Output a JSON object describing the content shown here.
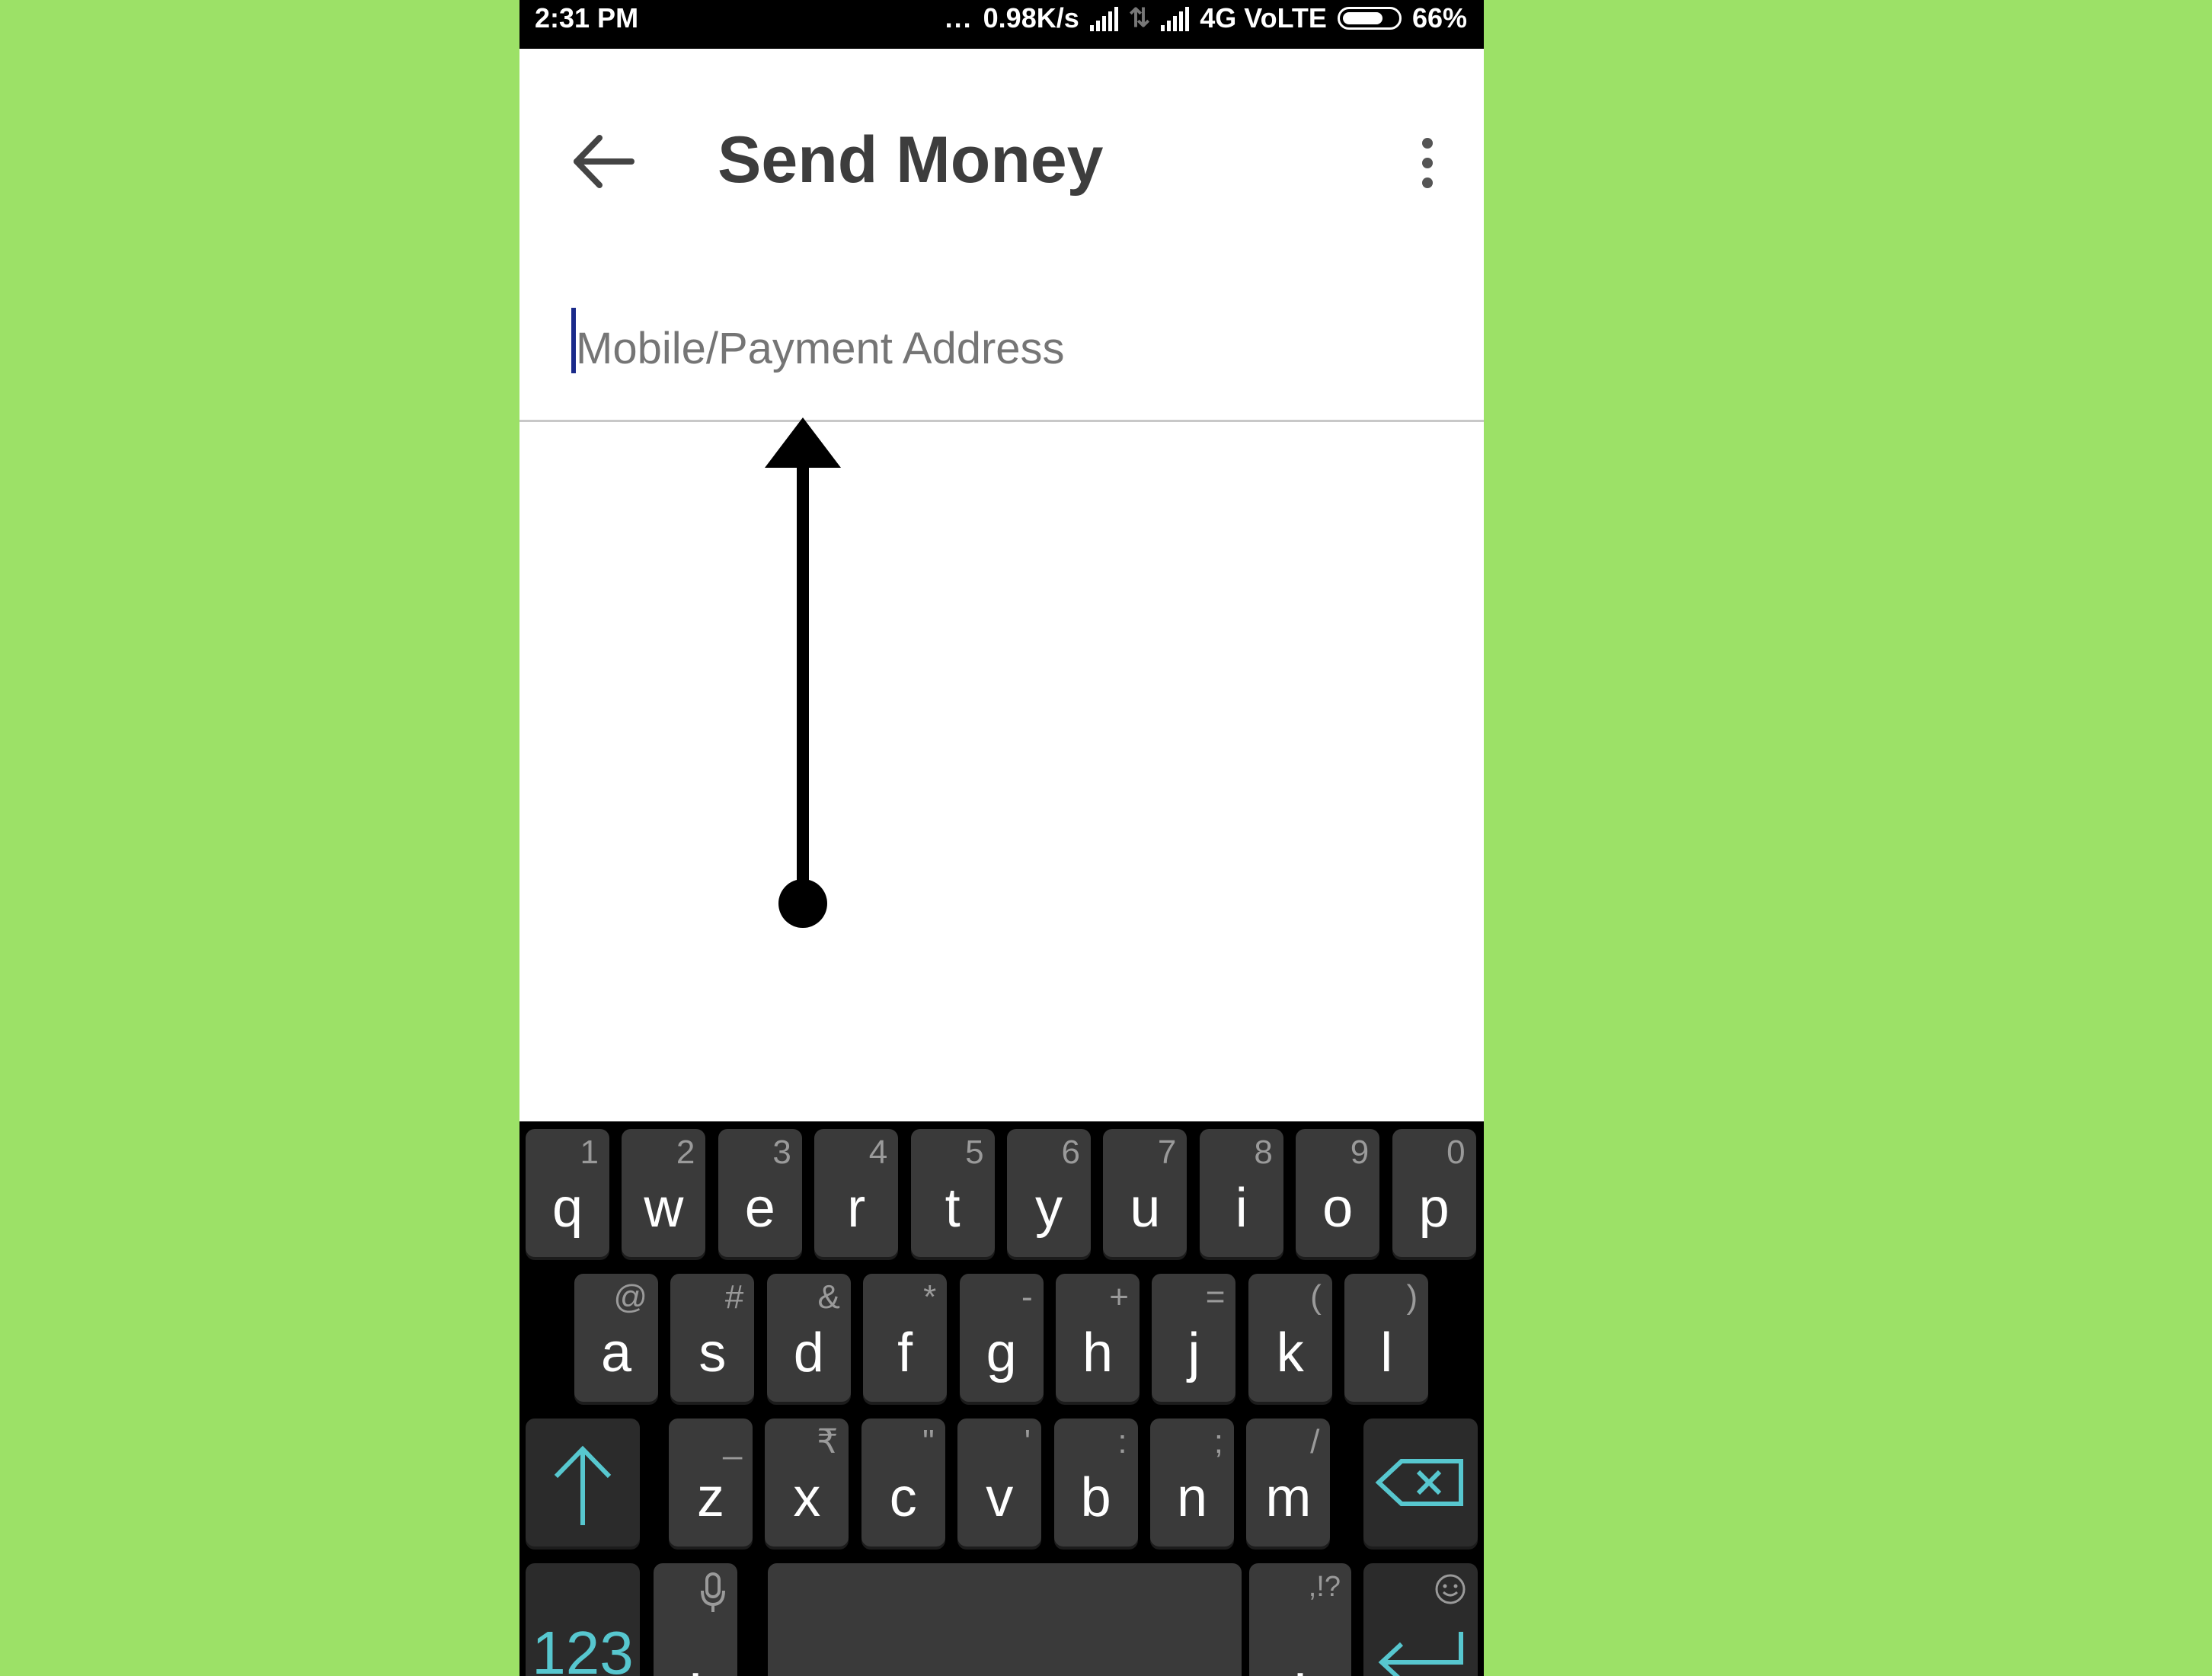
{
  "status_bar": {
    "time": "2:31 PM",
    "dots": "...",
    "speed": "0.98K/s",
    "network": "4G VoLTE",
    "battery": "66%"
  },
  "header": {
    "title": "Send Money",
    "back_icon": "arrow-left-icon",
    "menu_icon": "more-vertical-icon"
  },
  "input": {
    "placeholder": "Mobile/Payment Address",
    "value": ""
  },
  "keyboard": {
    "row1": [
      {
        "key": "q",
        "hint": "1"
      },
      {
        "key": "w",
        "hint": "2"
      },
      {
        "key": "e",
        "hint": "3"
      },
      {
        "key": "r",
        "hint": "4"
      },
      {
        "key": "t",
        "hint": "5"
      },
      {
        "key": "y",
        "hint": "6"
      },
      {
        "key": "u",
        "hint": "7"
      },
      {
        "key": "i",
        "hint": "8"
      },
      {
        "key": "o",
        "hint": "9"
      },
      {
        "key": "p",
        "hint": "0"
      }
    ],
    "row2": [
      {
        "key": "a",
        "hint": "@"
      },
      {
        "key": "s",
        "hint": "#"
      },
      {
        "key": "d",
        "hint": "&"
      },
      {
        "key": "f",
        "hint": "*"
      },
      {
        "key": "g",
        "hint": "-"
      },
      {
        "key": "h",
        "hint": "+"
      },
      {
        "key": "j",
        "hint": "="
      },
      {
        "key": "k",
        "hint": "("
      },
      {
        "key": "l",
        "hint": ")"
      }
    ],
    "row3": [
      {
        "key": "z",
        "hint": "_"
      },
      {
        "key": "x",
        "hint": "₹"
      },
      {
        "key": "c",
        "hint": "\""
      },
      {
        "key": "v",
        "hint": "'"
      },
      {
        "key": "b",
        "hint": ":"
      },
      {
        "key": "n",
        "hint": ";"
      },
      {
        "key": "m",
        "hint": "/"
      }
    ],
    "shift_icon": "shift-arrow-icon",
    "backspace_icon": "backspace-icon",
    "numbers_label": "123",
    "comma": {
      "key": ",",
      "hint_icon": "microphone-icon"
    },
    "period": {
      "key": ".",
      "hint": ",!?"
    },
    "enter_icon": "enter-icon",
    "emoji_icon": "smiley-icon",
    "accent_color": "#57c7cf"
  }
}
